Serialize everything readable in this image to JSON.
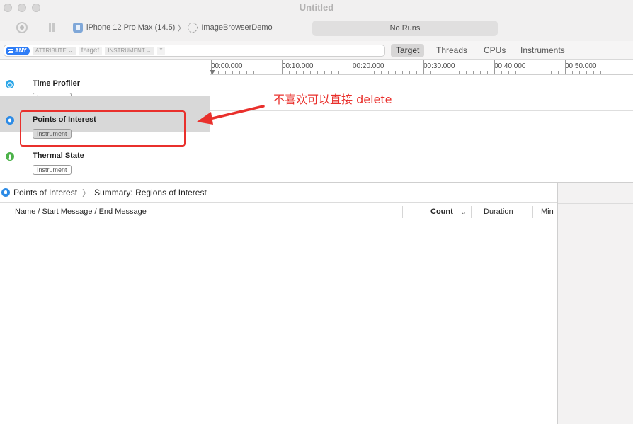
{
  "window": {
    "title": "Untitled"
  },
  "toolbar": {
    "device": "iPhone 12 Pro Max (14.5)",
    "target_app": "ImageBrowserDemo",
    "status": "No Runs"
  },
  "filter_bar": {
    "any_label": "ANY",
    "tokens": [
      "ATTRIBUTE",
      "target",
      "INSTRUMENT",
      "*"
    ],
    "segments": [
      "Target",
      "Threads",
      "CPUs",
      "Instruments"
    ],
    "selected_segment": "Target"
  },
  "timeline": {
    "ticks": [
      "00:00.000",
      "00:10.000",
      "00:20.000",
      "00:30.000",
      "00:40.000",
      "00:50.000"
    ]
  },
  "tracks": [
    {
      "name": "Time Profiler",
      "badge": "Instrument",
      "icon": "time-profiler-icon",
      "color": "#2aa6e8"
    },
    {
      "name": "Points of Interest",
      "badge": "Instrument",
      "icon": "points-of-interest-icon",
      "color": "#2c8be6",
      "selected": true
    },
    {
      "name": "Thermal State",
      "badge": "Instrument",
      "icon": "thermal-state-icon",
      "color": "#4cb24a"
    }
  ],
  "annotation": {
    "text": "不喜欢可以直接 delete",
    "color": "#e9302c"
  },
  "detail": {
    "breadcrumb": [
      "Points of Interest",
      "Summary: Regions of Interest"
    ],
    "columns": [
      "Name / Start Message / End Message",
      "Count",
      "Duration",
      "Min"
    ]
  }
}
